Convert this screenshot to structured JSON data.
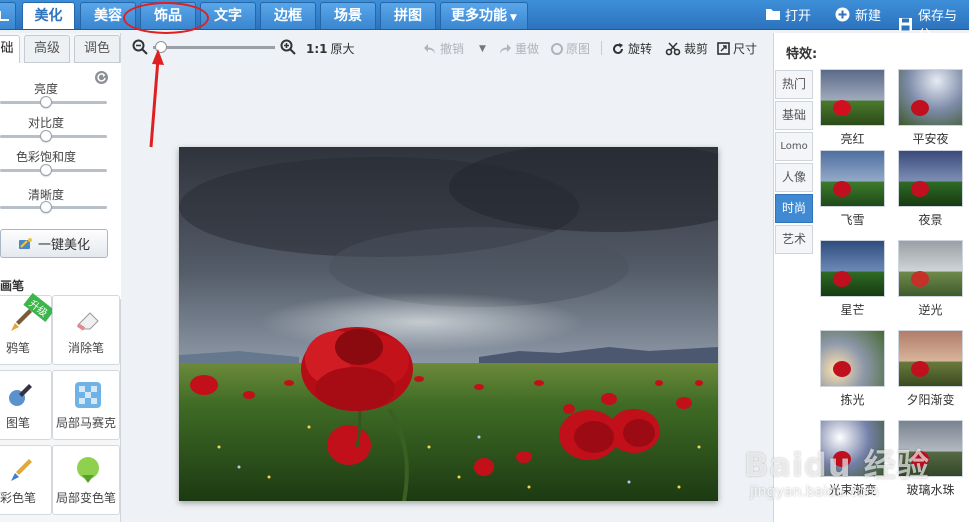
{
  "topbar": {
    "tabs": [
      {
        "label": "美化",
        "active": true
      },
      {
        "label": "美容",
        "active": false
      },
      {
        "label": "饰品",
        "active": false
      },
      {
        "label": "文字",
        "active": false
      },
      {
        "label": "边框",
        "active": false
      },
      {
        "label": "场景",
        "active": false
      },
      {
        "label": "拼图",
        "active": false
      },
      {
        "label": "更多功能",
        "active": false
      }
    ],
    "actions": {
      "open": "打开",
      "new": "新建",
      "save": "保存与分"
    }
  },
  "left_panel": {
    "subtabs": [
      "础",
      "高级",
      "调色"
    ],
    "adjustments": [
      {
        "label": "亮度",
        "value": 0.45
      },
      {
        "label": "对比度",
        "value": 0.45
      },
      {
        "label": "色彩饱和度",
        "value": 0.45
      },
      {
        "label": "清晰度",
        "value": 0.45
      }
    ],
    "onekey_label": "一键美化",
    "section_title": "画笔",
    "tools": [
      {
        "label": "鸦笔",
        "badge": "升级",
        "icon": "brush-icon"
      },
      {
        "label": "消除笔",
        "icon": "eraser-icon"
      },
      {
        "label": "图笔",
        "icon": "pen-icon"
      },
      {
        "label": "局部马赛克",
        "icon": "mosaic-icon"
      },
      {
        "label": "彩色笔",
        "icon": "color-brush-icon"
      },
      {
        "label": "局部变色笔",
        "icon": "color-change-icon"
      }
    ]
  },
  "toolbar": {
    "zoom_value": 0.05,
    "actual_size": "1:1",
    "original_size_label": "原大",
    "undo": "撤销",
    "redo": "重做",
    "original": "原图",
    "rotate": "旋转",
    "crop": "裁剪",
    "size": "尺寸"
  },
  "right_panel": {
    "title": "特效:",
    "categories": [
      {
        "label": "热门",
        "active": false
      },
      {
        "label": "基础",
        "active": false
      },
      {
        "label": "Lomo",
        "active": false
      },
      {
        "label": "人像",
        "active": false
      },
      {
        "label": "时尚",
        "active": true
      },
      {
        "label": "艺术",
        "active": false
      }
    ],
    "effects": [
      {
        "label": "亮红",
        "tint": "#5b6a88"
      },
      {
        "label": "平安夜",
        "tint": "#7d8ba8"
      },
      {
        "label": "飞雪",
        "tint": "#4f6fa0"
      },
      {
        "label": "夜景",
        "tint": "#3a4a7a"
      },
      {
        "label": "星芒",
        "tint": "#2e4c7e"
      },
      {
        "label": "逆光",
        "tint": "#9aa0a6"
      },
      {
        "label": "拣光",
        "tint": "#8d98aa"
      },
      {
        "label": "夕阳渐变",
        "tint": "#b07d6a"
      },
      {
        "label": "光束渐变",
        "tint": "#7480a8"
      },
      {
        "label": "玻璃水珠",
        "tint": "#7a8290"
      }
    ]
  },
  "watermark": {
    "brand": "Baidu 经验",
    "url": "jingyan.baidu.com"
  },
  "colors": {
    "accent": "#2d73be",
    "annotation": "#e02020"
  }
}
